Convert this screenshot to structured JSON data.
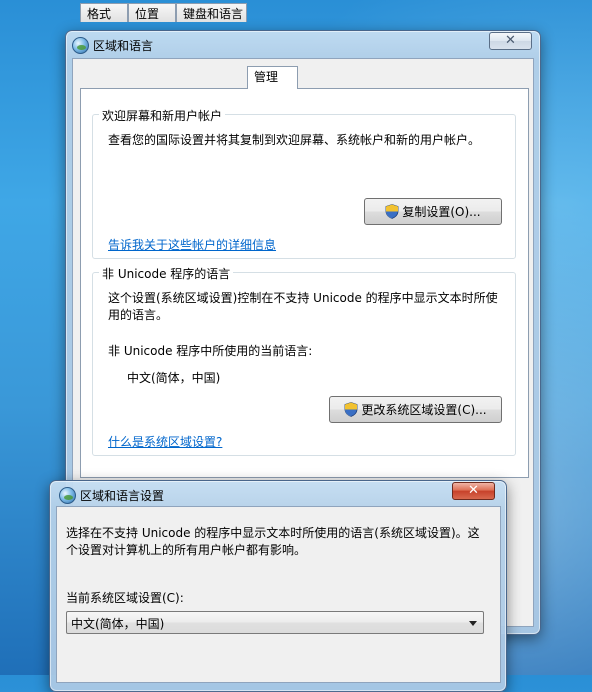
{
  "main_window": {
    "title": "区域和语言",
    "close_glyph": "✕",
    "tabs": [
      {
        "label": "格式"
      },
      {
        "label": "位置"
      },
      {
        "label": "键盘和语言"
      },
      {
        "label": "管理"
      }
    ],
    "welcome_group": {
      "label": "欢迎屏幕和新用户帐户",
      "description": "查看您的国际设置并将其复制到欢迎屏幕、系统帐户和新的用户帐户。",
      "copy_button": "复制设置(O)...",
      "link": "告诉我关于这些帐户的详细信息"
    },
    "unicode_group": {
      "label": "非 Unicode 程序的语言",
      "description_line1": "这个设置(系统区域设置)控制在不支持 Unicode 的程序中显示文本时所使",
      "description_line2": "用的语言。",
      "current_label": "非 Unicode 程序中所使用的当前语言:",
      "current_value": "中文(简体，中国)",
      "change_button": "更改系统区域设置(C)...",
      "link": "什么是系统区域设置?"
    }
  },
  "dialog": {
    "title": "区域和语言设置",
    "close_glyph": "✕",
    "description_line1": "选择在不支持 Unicode 的程序中显示文本时所使用的语言(系统区域设置)。这",
    "description_line2": "个设置对计算机上的所有用户帐户都有影响。",
    "current_label": "当前系统区域设置(C):",
    "selected_value": "中文(简体，中国)"
  },
  "icons": {
    "app": "globe-icon",
    "shield": "uac-shield-icon",
    "dropdown": "chevron-down-icon"
  },
  "colors": {
    "link": "#0066cc",
    "close_red": "#c7412a"
  }
}
